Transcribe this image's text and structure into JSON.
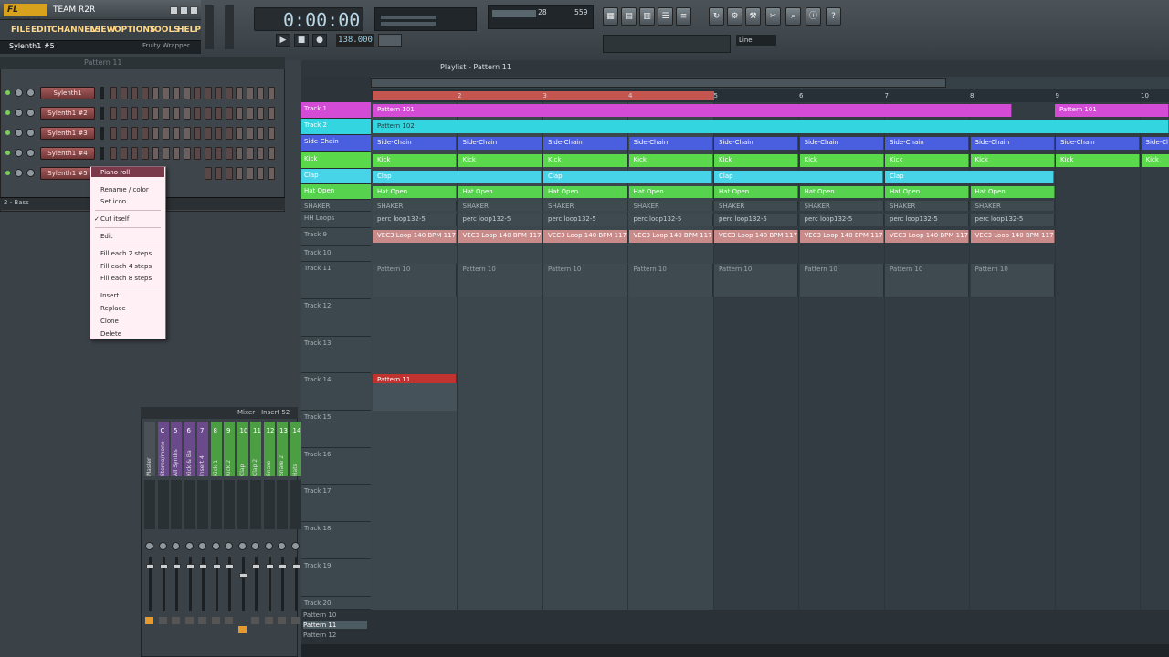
{
  "app": {
    "logo": "FL STUDIO",
    "title": "TEAM R2R"
  },
  "menu": [
    "FILE",
    "EDIT",
    "CHANNELS",
    "VIEW",
    "OPTIONS",
    "TOOLS",
    "HELP"
  ],
  "hint": {
    "left": "Sylenth1 #5",
    "right": "Fruity Wrapper"
  },
  "transport": {
    "time": "0:00:00",
    "tempo": "138.000",
    "cpu_a": "28",
    "cpu_b": "559",
    "snap": "Line",
    "play": "▶",
    "stop": "■",
    "rec": "●"
  },
  "channel_rack": {
    "title": "Pattern 11",
    "channels": [
      "Sylenth1",
      "Sylenth1 #2",
      "Sylenth1 #3",
      "Sylenth1 #4",
      "Sylenth1 #5"
    ],
    "filter": "2 - Bass"
  },
  "context_menu": {
    "items": [
      "Piano roll",
      "Rename / color",
      "Set icon",
      "Cut itself",
      "Edit",
      "Fill each 2 steps",
      "Fill each 4 steps",
      "Fill each 8 steps",
      "Insert",
      "Replace",
      "Clone",
      "Delete"
    ]
  },
  "mixer": {
    "title": "Mixer - Insert 52",
    "inserts": [
      "Master",
      "Stereo/mono",
      "All Synths",
      "Kick & Ba",
      "Insert 4",
      "Kick 1",
      "Kick 2",
      "Clap",
      "Clap 2",
      "Snare",
      "Snare 2",
      "Hats"
    ],
    "numbers": [
      "",
      "C",
      "5",
      "6",
      "7",
      "8",
      "9",
      "10",
      "11",
      "12",
      "13",
      "14"
    ]
  },
  "playlist": {
    "title": "Playlist - Pattern 11",
    "ruler": [
      "2",
      "3",
      "4",
      "5",
      "6",
      "7",
      "8",
      "9",
      "10"
    ],
    "tracks": [
      "Track 1",
      "Track 2",
      "Side-Chain",
      "Kick",
      "Clap",
      "Hat Open",
      "SHAKER",
      "HH Loops",
      "Track 9",
      "Track 10",
      "Track 11",
      "Track 12",
      "Track 13",
      "Track 14",
      "Track 15",
      "Track 16",
      "Track 17",
      "Track 18",
      "Track 19",
      "Track 20"
    ],
    "clips": {
      "pattern101": "Pattern 101",
      "pattern102": "Pattern 102",
      "sidechain": "Side-Chain",
      "kick": "Kick",
      "clap": "Clap",
      "hatopen": "Hat Open",
      "shaker": "SHAKER",
      "perc": "perc loop132-5",
      "vec": "VEC3 Loop 140 BPM 117",
      "pattern10": "Pattern 10",
      "pattern11": "Pattern 11"
    },
    "footer": [
      "Pattern 10",
      "Pattern 11",
      "Pattern 12"
    ]
  },
  "colors": {
    "accent": "#d9a21c",
    "track1": "#d44bd6",
    "track2": "#33d6e0",
    "sidechain": "#4a5ee0",
    "kick": "#5ad94a",
    "clap": "#48d4e8",
    "hat": "#57d24f",
    "vec": "#c98a8a",
    "pattern11": "#c0332f"
  }
}
